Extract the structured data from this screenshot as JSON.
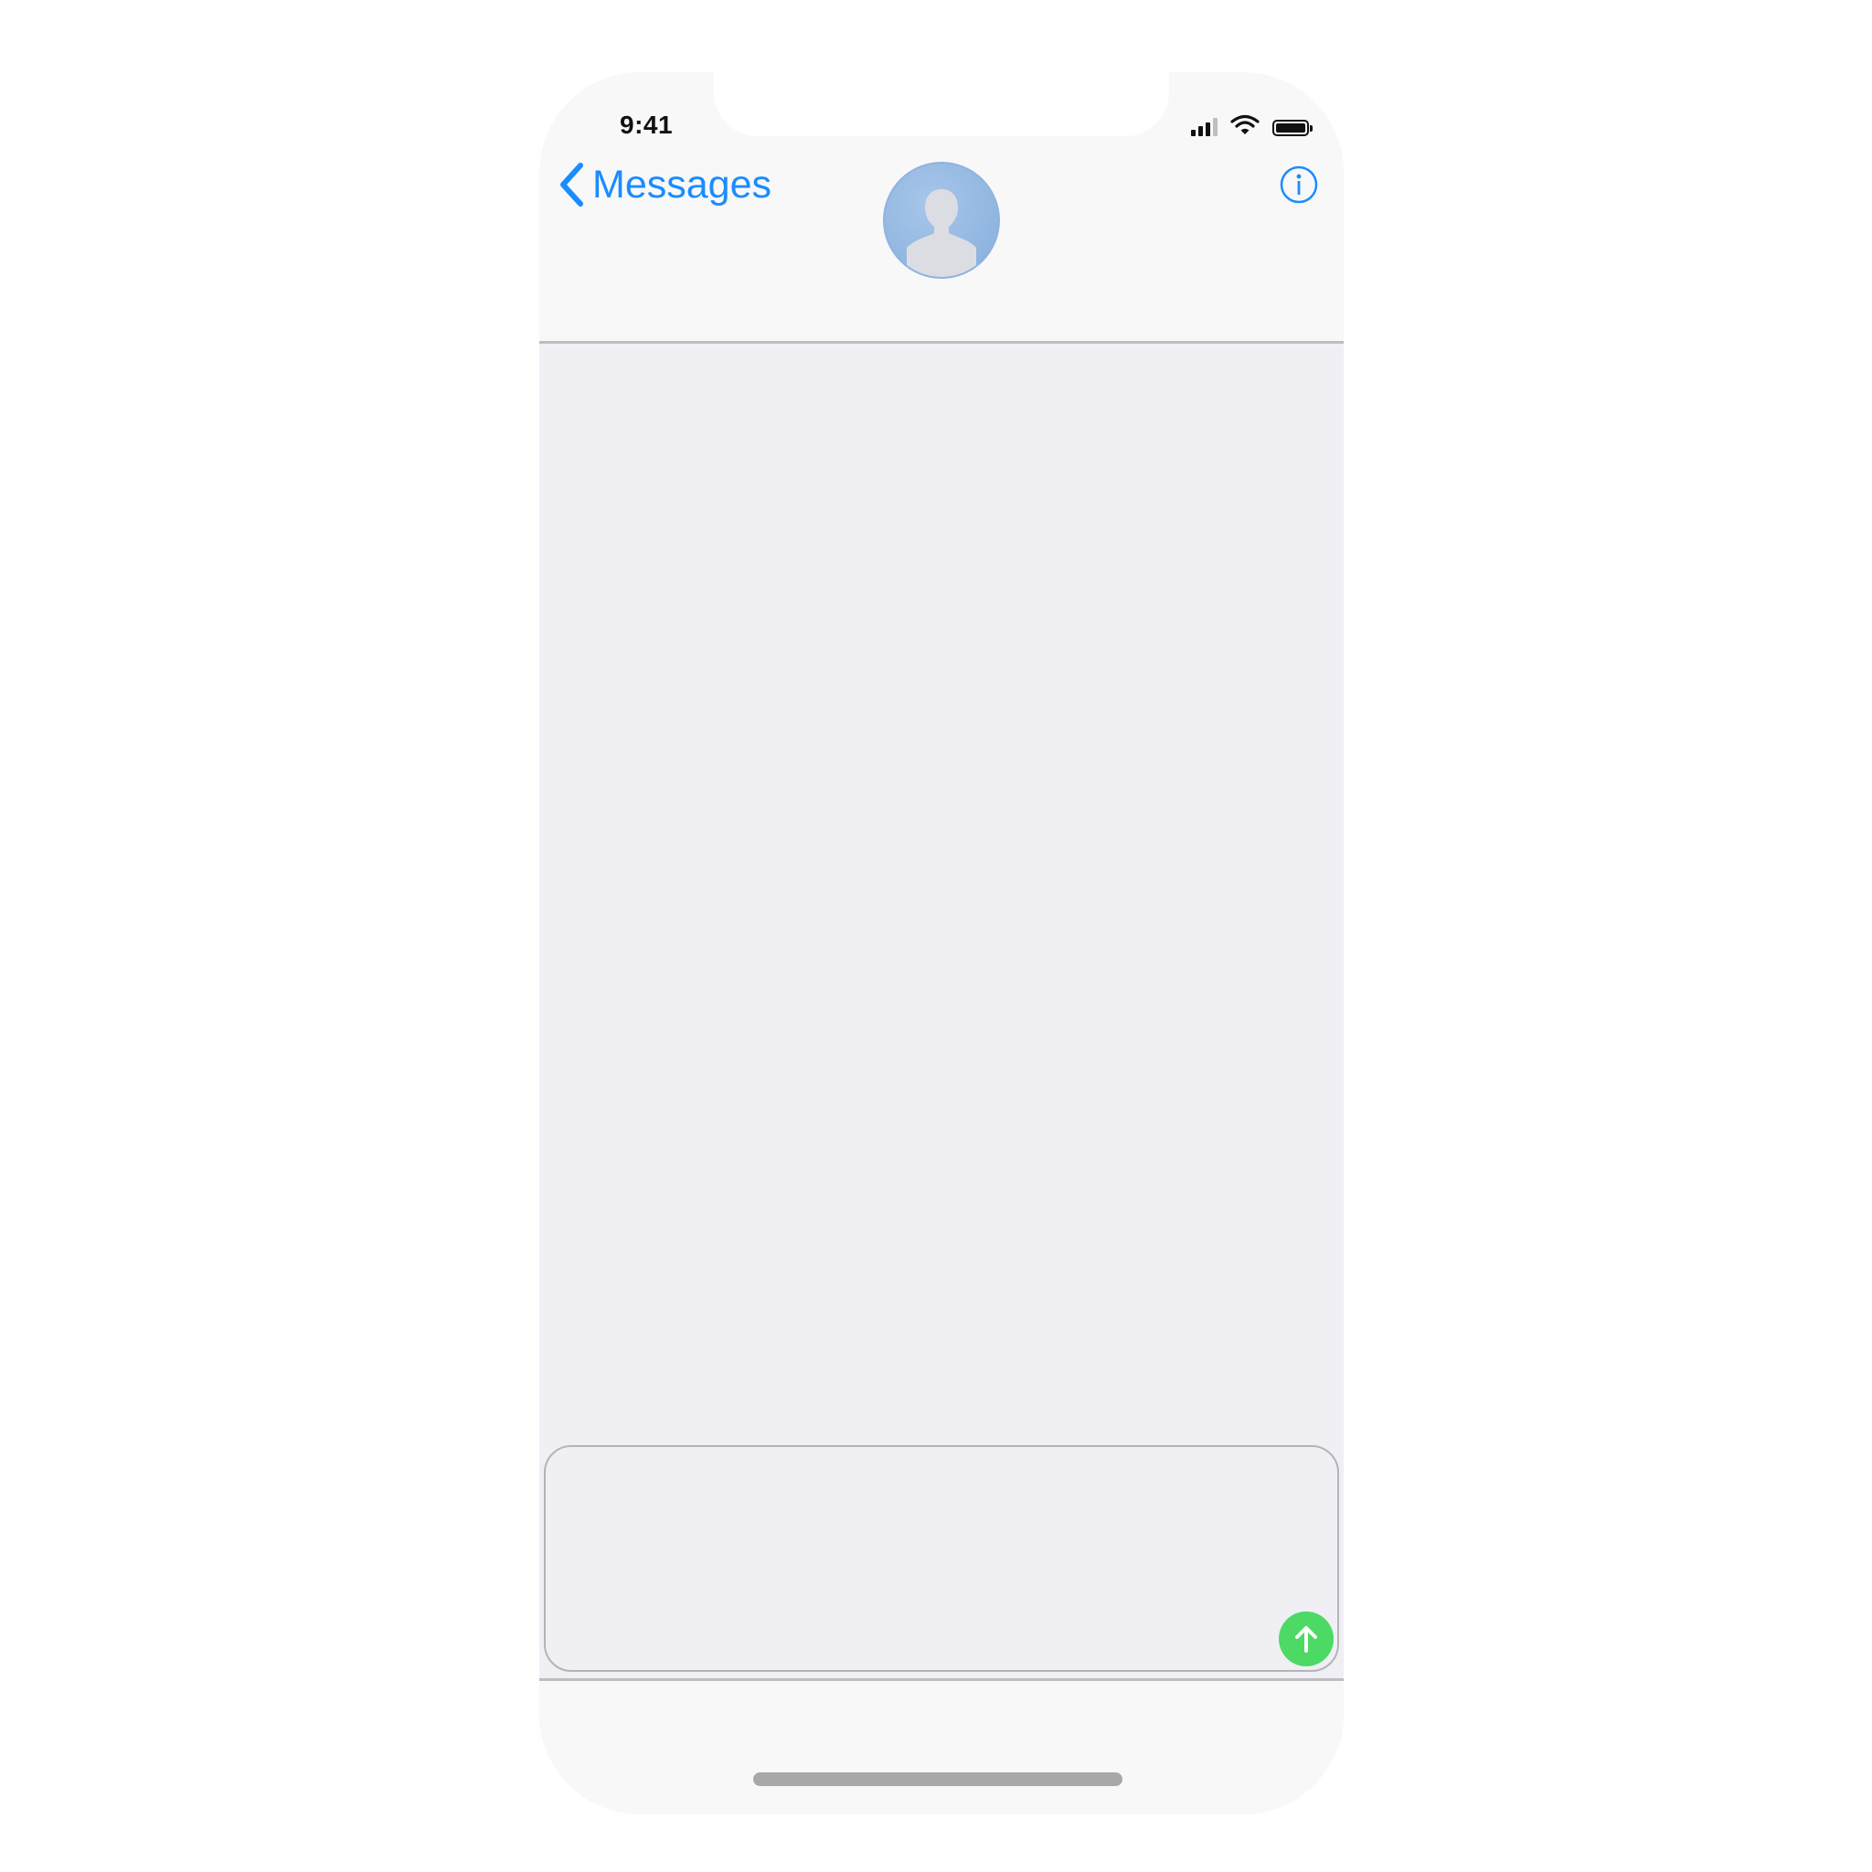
{
  "status_bar": {
    "time": "9:41",
    "icons": [
      "cellular-signal-icon",
      "wifi-icon",
      "battery-icon"
    ]
  },
  "nav": {
    "back_label": "Messages",
    "back_icon": "chevron-left-icon",
    "info_icon": "info-icon",
    "avatar_icon": "person-silhouette-icon"
  },
  "composer": {
    "send_icon": "arrow-up-icon"
  },
  "colors": {
    "accent": "#1a8cff",
    "send": "#4cd964",
    "conversation_bg": "#efeff4",
    "bar_bg": "#f8f8f8",
    "avatar": "#8fb3e0"
  }
}
